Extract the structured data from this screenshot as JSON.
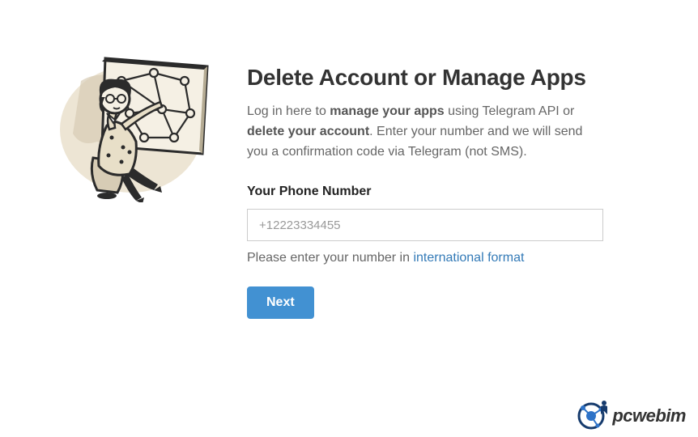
{
  "heading": "Delete Account or Manage Apps",
  "intro_pre": "Log in here to ",
  "intro_bold1": "manage your apps",
  "intro_mid": " using Telegram API or ",
  "intro_bold2": "delete your account",
  "intro_post": ". Enter your number and we will send you a confirmation code via Telegram (not SMS).",
  "phone_label": "Your Phone Number",
  "phone_placeholder": "+12223334455",
  "help_pre": "Please enter your number in ",
  "help_link": "international format",
  "next_label": "Next",
  "watermark": "pcwebim",
  "colors": {
    "primary_button": "#4291d2",
    "link": "#337ab7"
  }
}
